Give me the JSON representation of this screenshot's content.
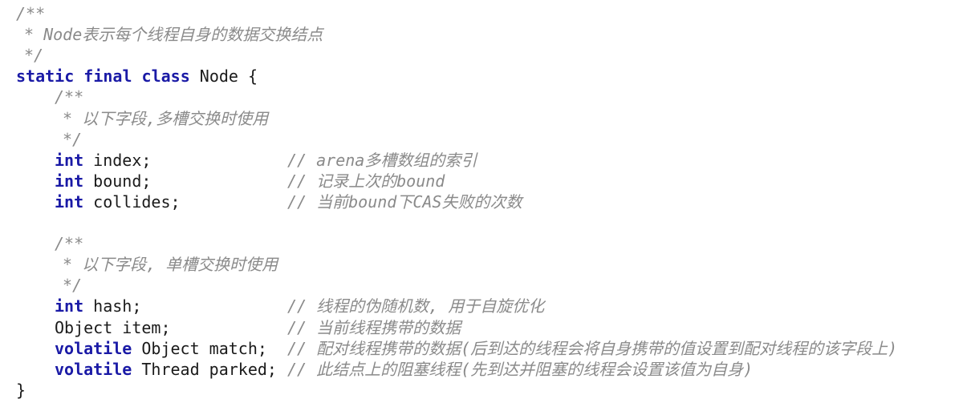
{
  "editor": {
    "lines": [
      {
        "kind": "comment",
        "indent": 0,
        "text": "/**"
      },
      {
        "kind": "comment",
        "indent": 1,
        "text": "* Node表示每个线程自身的数据交换结点"
      },
      {
        "kind": "comment",
        "indent": 1,
        "text": "*/"
      },
      {
        "kind": "code",
        "indent": 0,
        "kw": "static final class",
        "rest": " Node {",
        "comment": ""
      },
      {
        "kind": "comment",
        "indent": 2,
        "text": "/**"
      },
      {
        "kind": "comment",
        "indent": 3,
        "text": "* 以下字段,多槽交换时使用"
      },
      {
        "kind": "comment",
        "indent": 3,
        "text": "*/"
      },
      {
        "kind": "code",
        "indent": 2,
        "kw": "int",
        "rest": " index;",
        "comment": "// arena多槽数组的索引"
      },
      {
        "kind": "code",
        "indent": 2,
        "kw": "int",
        "rest": " bound;",
        "comment": "// 记录上次的bound"
      },
      {
        "kind": "code",
        "indent": 2,
        "kw": "int",
        "rest": " collides;",
        "comment": "// 当前bound下CAS失败的次数"
      },
      {
        "kind": "blank",
        "indent": 0,
        "text": ""
      },
      {
        "kind": "comment",
        "indent": 2,
        "text": "/**"
      },
      {
        "kind": "comment",
        "indent": 3,
        "text": "* 以下字段, 单槽交换时使用"
      },
      {
        "kind": "comment",
        "indent": 3,
        "text": "*/"
      },
      {
        "kind": "code",
        "indent": 2,
        "kw": "int",
        "rest": " hash;",
        "comment": "// 线程的伪随机数, 用于自旋优化"
      },
      {
        "kind": "code",
        "indent": 2,
        "kw": "",
        "rest": "Object item;",
        "comment": "// 当前线程携带的数据"
      },
      {
        "kind": "code",
        "indent": 2,
        "kw": "volatile",
        "rest": " Object match;",
        "comment": "// 配对线程携带的数据(后到达的线程会将自身携带的值设置到配对线程的该字段上)"
      },
      {
        "kind": "code",
        "indent": 2,
        "kw": "volatile",
        "rest": " Thread parked;",
        "comment": "// 此结点上的阻塞线程(先到达并阻塞的线程会设置该值为自身)"
      },
      {
        "kind": "code",
        "indent": 0,
        "kw": "",
        "rest": "}",
        "comment": ""
      }
    ]
  }
}
